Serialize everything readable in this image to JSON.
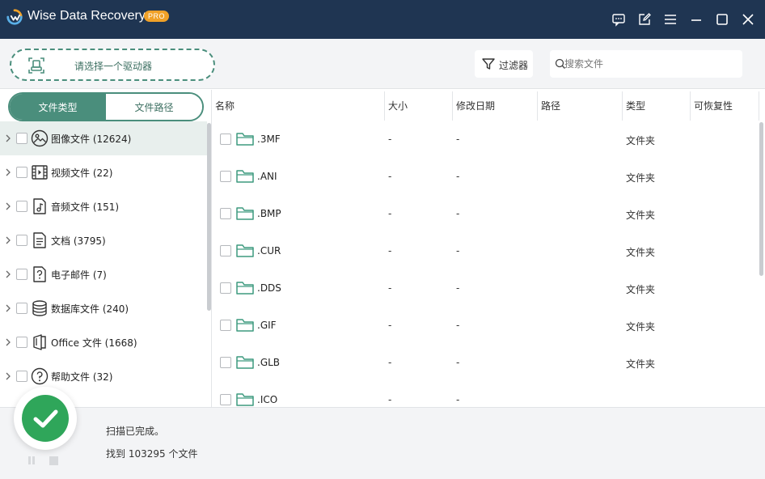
{
  "app": {
    "title": "Wise Data Recovery",
    "badge": "PRO"
  },
  "titlebar": {
    "buttons": [
      "feedback-icon",
      "edit-icon",
      "menu-icon",
      "minimize-icon",
      "maximize-icon",
      "close-icon"
    ]
  },
  "toolbar": {
    "drive_select_label": "请选择一个驱动器",
    "filter_label": "过滤器",
    "search_placeholder": "搜索文件",
    "search_value": ""
  },
  "sidebar": {
    "tabs": [
      {
        "label": "文件类型",
        "active": true
      },
      {
        "label": "文件路径",
        "active": false
      }
    ],
    "categories": [
      {
        "label": "图像文件 (12624)",
        "icon": "image-icon",
        "selected": true
      },
      {
        "label": "视频文件 (22)",
        "icon": "video-icon",
        "selected": false
      },
      {
        "label": "音频文件 (151)",
        "icon": "audio-icon",
        "selected": false
      },
      {
        "label": "文档 (3795)",
        "icon": "document-icon",
        "selected": false
      },
      {
        "label": "电子邮件 (7)",
        "icon": "email-icon",
        "selected": false
      },
      {
        "label": "数据库文件 (240)",
        "icon": "database-icon",
        "selected": false
      },
      {
        "label": "Office 文件 (1668)",
        "icon": "office-icon",
        "selected": false
      },
      {
        "label": "帮助文件 (32)",
        "icon": "help-icon",
        "selected": false
      }
    ]
  },
  "table": {
    "columns": [
      "名称",
      "大小",
      "修改日期",
      "路径",
      "类型",
      "可恢复性"
    ],
    "rows": [
      {
        "name": ".3MF",
        "size": "-",
        "date": "-",
        "path": "",
        "type": "文件夹",
        "recoverability": ""
      },
      {
        "name": ".ANI",
        "size": "-",
        "date": "-",
        "path": "",
        "type": "文件夹",
        "recoverability": ""
      },
      {
        "name": ".BMP",
        "size": "-",
        "date": "-",
        "path": "",
        "type": "文件夹",
        "recoverability": ""
      },
      {
        "name": ".CUR",
        "size": "-",
        "date": "-",
        "path": "",
        "type": "文件夹",
        "recoverability": ""
      },
      {
        "name": ".DDS",
        "size": "-",
        "date": "-",
        "path": "",
        "type": "文件夹",
        "recoverability": ""
      },
      {
        "name": ".GIF",
        "size": "-",
        "date": "-",
        "path": "",
        "type": "文件夹",
        "recoverability": ""
      },
      {
        "name": ".GLB",
        "size": "-",
        "date": "-",
        "path": "",
        "type": "文件夹",
        "recoverability": ""
      },
      {
        "name": ".ICO",
        "size": "-",
        "date": "-",
        "path": "",
        "type": "",
        "recoverability": ""
      }
    ]
  },
  "status": {
    "line1": "扫描已完成。",
    "line2": "找到 103295 个文件"
  },
  "colors": {
    "titlebar": "#1f3552",
    "accent": "#4a8e7c",
    "success": "#2fa65a",
    "badge": "#f0a128"
  }
}
